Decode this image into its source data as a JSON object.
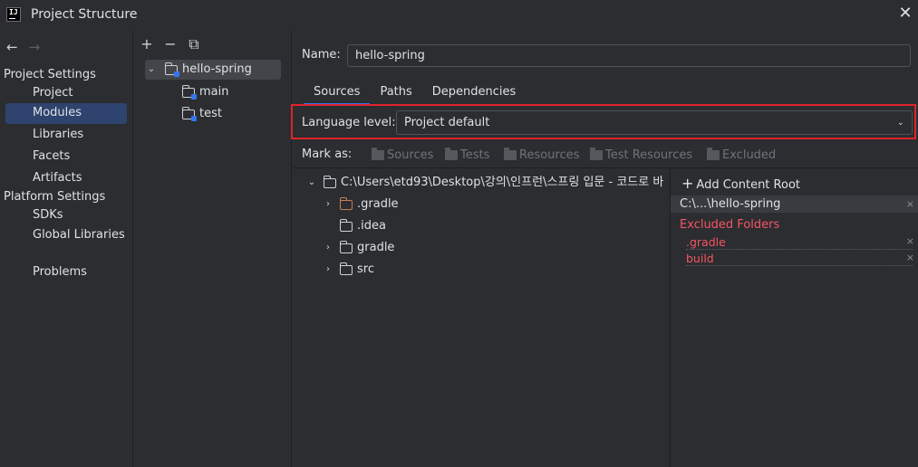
{
  "window": {
    "title": "Project Structure"
  },
  "nav": {
    "back": "←",
    "forward": "→",
    "project_settings_header": "Project Settings",
    "project_settings_items": [
      "Project",
      "Modules",
      "Libraries",
      "Facets",
      "Artifacts"
    ],
    "selected_item": "Modules",
    "platform_settings_header": "Platform Settings",
    "platform_settings_items": [
      "SDKs",
      "Global Libraries"
    ],
    "problems": "Problems"
  },
  "module_tree": {
    "toolbar": {
      "add": "+",
      "remove": "−",
      "copy": "⧉"
    },
    "root": "hello-spring",
    "children": [
      "main",
      "test"
    ]
  },
  "module": {
    "name_label": "Name:",
    "name_value": "hello-spring",
    "tabs": [
      "Sources",
      "Paths",
      "Dependencies"
    ],
    "active_tab": "Sources",
    "language_level_label": "Language level:",
    "language_level_value": "Project default",
    "mark_as_label": "Mark as:",
    "mark_as_buttons": [
      "Sources",
      "Tests",
      "Resources",
      "Test Resources",
      "Excluded"
    ]
  },
  "file_tree": {
    "root": "C:\\Users\\etd93\\Desktop\\강의\\인프런\\스프링 입문 - 코드로 바",
    "children": [
      {
        "label": ".gradle",
        "expandable": true,
        "color": "#c77d55"
      },
      {
        "label": ".idea",
        "expandable": false,
        "color": "#ced0d6"
      },
      {
        "label": "gradle",
        "expandable": true,
        "color": "#ced0d6"
      },
      {
        "label": "src",
        "expandable": true,
        "color": "#ced0d6"
      }
    ]
  },
  "content_root": {
    "add_label": "Add Content Root",
    "path": "C:\\...\\hello-spring",
    "excluded_title": "Excluded Folders",
    "excluded": [
      ".gradle",
      "build"
    ],
    "remove_glyph": "×"
  },
  "colors": {
    "accent": "#3574f0",
    "selection": "#2e436e",
    "highlight_border": "#e0242a",
    "excluded_text": "#f75464"
  }
}
